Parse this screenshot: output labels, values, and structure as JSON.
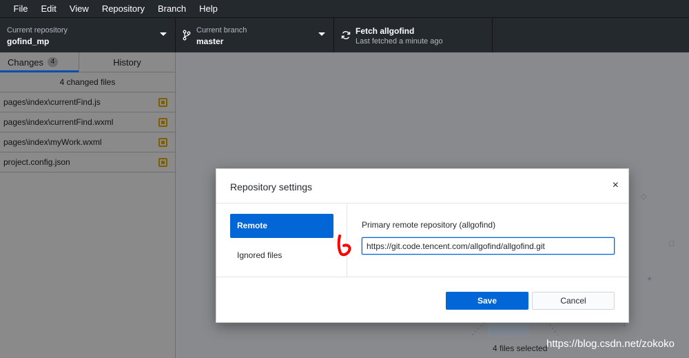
{
  "menu": [
    "File",
    "Edit",
    "View",
    "Repository",
    "Branch",
    "Help"
  ],
  "toolbar": {
    "repo": {
      "label": "Current repository",
      "value": "gofind_mp"
    },
    "branch": {
      "label": "Current branch",
      "value": "master"
    },
    "fetch": {
      "label": "Fetch allgofind",
      "value": "Last fetched a minute ago"
    }
  },
  "sidebar": {
    "tabs": {
      "changes": "Changes",
      "changes_count": "4",
      "history": "History"
    },
    "summary": "4 changed files",
    "files": [
      "pages\\index\\currentFind.js",
      "pages\\index\\currentFind.wxml",
      "pages\\index\\myWork.wxml",
      "project.config.json"
    ]
  },
  "main": {
    "selected": "4 files selected"
  },
  "watermark": "https://blog.csdn.net/zokoko",
  "dialog": {
    "title": "Repository settings",
    "close": "×",
    "nav": [
      "Remote",
      "Ignored files"
    ],
    "field_label": "Primary remote repository (allgofind)",
    "field_value": "https://git.code.tencent.com/allgofind/allgofind.git",
    "save": "Save",
    "cancel": "Cancel"
  },
  "colors": {
    "accent": "#0366d6",
    "toolbar": "#24292e",
    "modified": "#7d5f00",
    "annotation": "#ff0000"
  }
}
